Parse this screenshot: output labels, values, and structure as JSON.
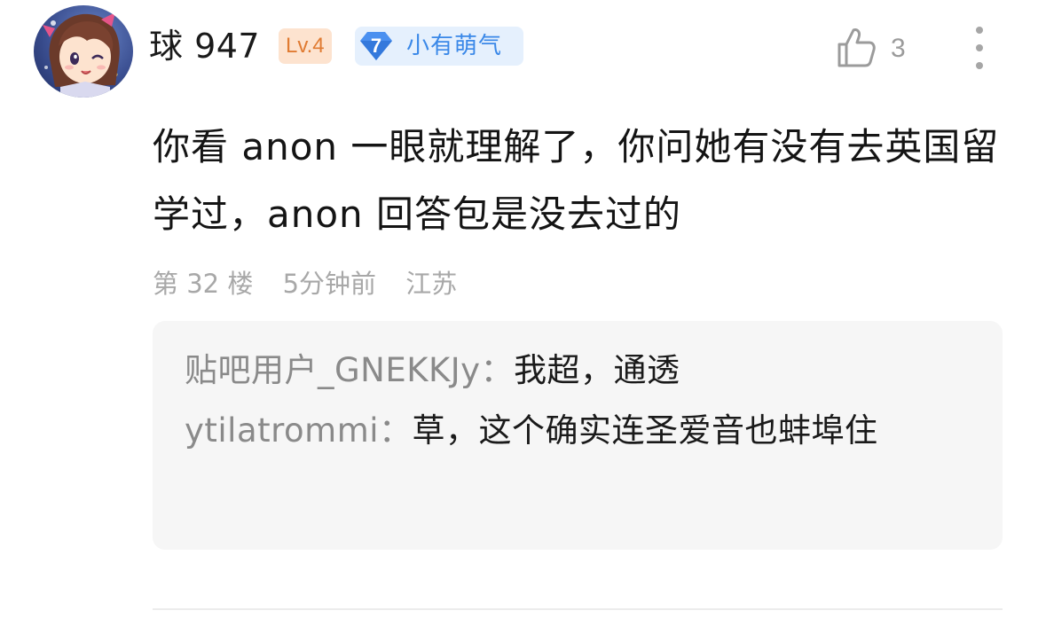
{
  "post": {
    "username": "球 947",
    "level_badge": "Lv.4",
    "title_badge": {
      "number": "7",
      "text": "小有萌气"
    },
    "like_count": "3",
    "content": "你看 anon 一眼就理解了，你问她有没有去英国留学过，anon 回答包是没去过的",
    "meta": {
      "floor": "第 32 楼",
      "time": "5分钟前",
      "location": "江苏"
    },
    "replies": [
      {
        "author": "贴吧用户_GNEKKJy",
        "separator": "：",
        "text": "我超，通透"
      },
      {
        "author": "ytilatrommi",
        "separator": "：",
        "text": "草，这个确实连圣爱音也蚌埠住"
      }
    ],
    "colors": {
      "level_badge_bg": "#fde3cf",
      "level_badge_text": "#e07b32",
      "title_badge_bg": "#e5f0fd",
      "title_badge_text": "#3a88e8",
      "meta_text": "#a8a8a8",
      "reply_bg": "#f6f6f6"
    },
    "icons": {
      "like": "thumbs-up-outline-icon",
      "more": "vertical-ellipsis-icon",
      "gem": "diamond-icon"
    }
  }
}
